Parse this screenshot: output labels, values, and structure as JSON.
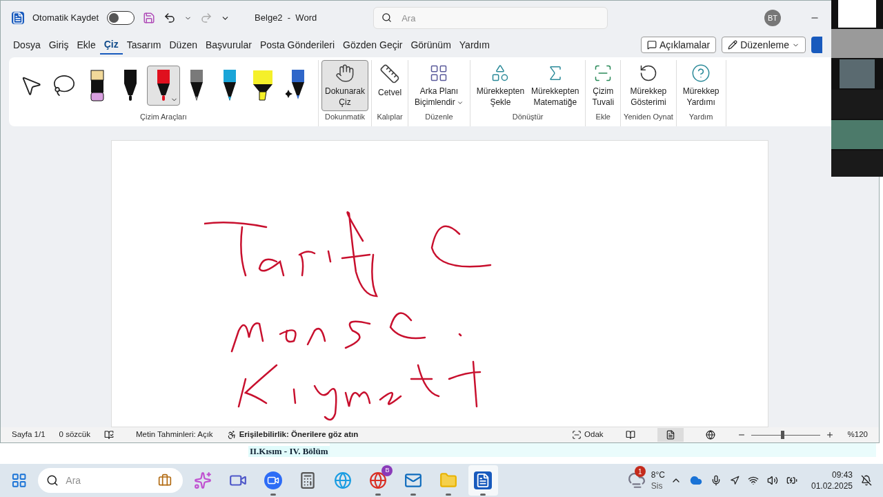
{
  "title_bar": {
    "autosave_label": "Otomatik Kaydet",
    "autosave_on": false,
    "doc_title": "Belge2  -  Word",
    "search_placeholder": "Ara",
    "avatar": "BT"
  },
  "tabs": [
    {
      "label": "Dosya",
      "selected": false
    },
    {
      "label": "Giriş",
      "selected": false
    },
    {
      "label": "Ekle",
      "selected": false
    },
    {
      "label": "Çiz",
      "selected": true
    },
    {
      "label": "Tasarım",
      "selected": false
    },
    {
      "label": "Düzen",
      "selected": false
    },
    {
      "label": "Başvurular",
      "selected": false
    },
    {
      "label": "Posta Gönderileri",
      "selected": false
    },
    {
      "label": "Gözden Geçir",
      "selected": false
    },
    {
      "label": "Görünüm",
      "selected": false
    },
    {
      "label": "Yardım",
      "selected": false
    }
  ],
  "comments_button": "Açıklamalar",
  "editing_button": "Düzenleme",
  "drawing_tools": {
    "label": "Çizim Araçları",
    "tools": [
      {
        "kind": "select",
        "selected": false
      },
      {
        "kind": "lasso",
        "selected": false
      },
      {
        "kind": "eraser",
        "selected": false
      },
      {
        "kind": "pen",
        "color": "#111111",
        "selected": false
      },
      {
        "kind": "pen",
        "color": "#e0101e",
        "selected": true
      },
      {
        "kind": "pencil",
        "color": "#7a7a7a",
        "selected": false
      },
      {
        "kind": "pencil",
        "color": "#1aa5d8",
        "selected": false
      },
      {
        "kind": "highlighter",
        "color": "#f5f02a",
        "selected": false
      },
      {
        "kind": "action-pen",
        "color": "#2f66c9",
        "selected": false
      }
    ]
  },
  "ribbon_groups": [
    {
      "label": "Dokunmatik",
      "buttons": [
        {
          "kind": "draw-touch",
          "label": "Dokunarak\nÇiz",
          "selected": true
        }
      ]
    },
    {
      "label": "Kalıplar",
      "buttons": [
        {
          "kind": "ruler",
          "label": "Cetvel",
          "selected": false
        }
      ]
    },
    {
      "label": "Düzenle",
      "buttons": [
        {
          "kind": "background",
          "label": "Arka Planı\nBiçimlendir",
          "selected": false,
          "dropdown": true
        }
      ]
    },
    {
      "label": "Dönüştür",
      "buttons": [
        {
          "kind": "ink-shape",
          "label": "Mürekkepten\nŞekle",
          "selected": false
        },
        {
          "kind": "ink-math",
          "label": "Mürekkepten\nMatematiğe",
          "selected": false
        }
      ]
    },
    {
      "label": "Ekle",
      "buttons": [
        {
          "kind": "canvas",
          "label": "Çizim\nTuvali",
          "selected": false
        }
      ]
    },
    {
      "label": "Yeniden Oynat",
      "buttons": [
        {
          "kind": "replay",
          "label": "Mürekkep\nGösterimi",
          "selected": false
        }
      ]
    },
    {
      "label": "Yardım",
      "buttons": [
        {
          "kind": "help",
          "label": "Mürekkep\nYardımı",
          "selected": false
        }
      ]
    }
  ],
  "status_bar": {
    "page": "Sayfa 1/1",
    "words": "0 sözcük",
    "predictions": "Metin Tahminleri: Açık",
    "accessibility": "Erişilebilirlik: Önerilere göz atın",
    "focus": "Odak",
    "views": [
      {
        "kind": "read",
        "selected": false
      },
      {
        "kind": "print",
        "selected": true
      },
      {
        "kind": "web",
        "selected": false
      }
    ],
    "zoom": {
      "level": 0.45,
      "reading": "%120"
    }
  },
  "background_document": {
    "heading": "II.Kısım - IV. Bölüm"
  },
  "taskbar": {
    "search_placeholder": "Ara",
    "apps": [
      {
        "kind": "copilot",
        "running": false
      },
      {
        "kind": "teams",
        "running": false
      },
      {
        "kind": "zoom",
        "running": true
      },
      {
        "kind": "calculator",
        "running": false
      },
      {
        "kind": "edge",
        "running": false
      },
      {
        "kind": "chrome",
        "running": true,
        "badge": "B"
      },
      {
        "kind": "outlook",
        "running": true
      },
      {
        "kind": "explorer",
        "running": true
      },
      {
        "kind": "word",
        "running": true
      }
    ],
    "weather": {
      "badge": "1",
      "temperature": "8°C",
      "condition": "Sis"
    },
    "time": "09:43",
    "date": "01.02.2025"
  }
}
